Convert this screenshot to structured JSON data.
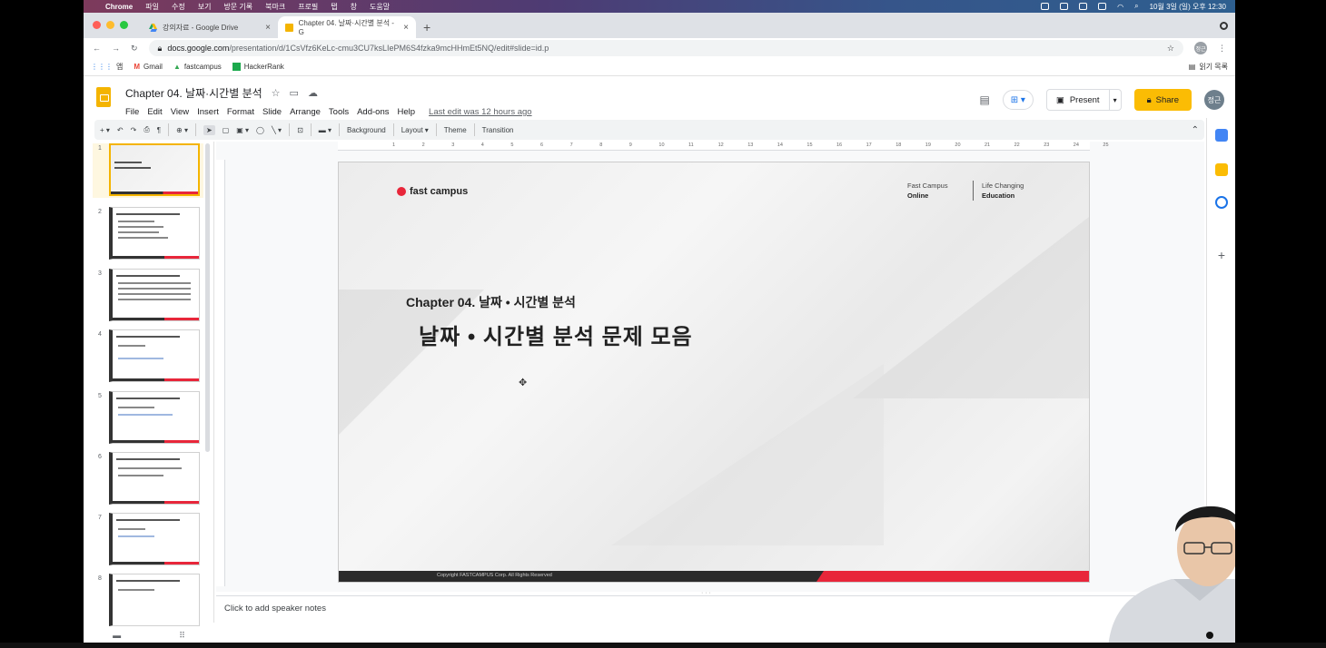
{
  "macbar": {
    "app": "Chrome",
    "menus": [
      "파일",
      "수정",
      "보기",
      "방문 기록",
      "북마크",
      "프로필",
      "탭",
      "창",
      "도움말"
    ],
    "clock": "10월 3일 (일) 오후 12:30"
  },
  "tabs": [
    {
      "label": "강의자료 - Google Drive",
      "active": false
    },
    {
      "label": "Chapter 04. 날짜·시간별 분석 - G",
      "active": true
    }
  ],
  "address": {
    "host": "docs.google.com",
    "path": "/presentation/d/1CsVfz6KeLc-cmu3CU7ksLIePM6S4fzka9mcHHmEt5NQ/edit#slide=id.p",
    "profile": "정근"
  },
  "bookmarks": {
    "apps": "앱",
    "items": [
      "Gmail",
      "fastcampus",
      "HackerRank"
    ],
    "reading_list": "읽기 목록"
  },
  "doc": {
    "title": "Chapter 04. 날짜·시간별 분석",
    "menus": [
      "File",
      "Edit",
      "View",
      "Insert",
      "Format",
      "Slide",
      "Arrange",
      "Tools",
      "Add-ons",
      "Help"
    ],
    "last_edit": "Last edit was 12 hours ago",
    "present_label": "Present",
    "share_label": "Share",
    "avatar": "정근"
  },
  "toolbar": {
    "background": "Background",
    "layout": "Layout",
    "theme": "Theme",
    "transition": "Transition"
  },
  "ruler_ticks": [
    "1",
    "2",
    "3",
    "4",
    "5",
    "6",
    "7",
    "8",
    "9",
    "10",
    "11",
    "12",
    "13",
    "14",
    "15",
    "16",
    "17",
    "18",
    "19",
    "20",
    "21",
    "22",
    "23",
    "24",
    "25"
  ],
  "slides": [
    {
      "num": "1",
      "selected": true
    },
    {
      "num": "2",
      "selected": false
    },
    {
      "num": "3",
      "selected": false
    },
    {
      "num": "4",
      "selected": false
    },
    {
      "num": "5",
      "selected": false
    },
    {
      "num": "6",
      "selected": false
    },
    {
      "num": "7",
      "selected": false
    },
    {
      "num": "8",
      "selected": false
    }
  ],
  "slide": {
    "brand": "fast campus",
    "tagline_left_1": "Fast Campus",
    "tagline_left_2": "Online",
    "tagline_right_1": "Life Changing",
    "tagline_right_2": "Education",
    "chapter": "Chapter  04. 날짜 • 시간별 분석",
    "title": "날짜 • 시간별 분석 문제 모음",
    "copyright": "Copyright FASTCAMPUS Corp. All Rights Reserved"
  },
  "notes": {
    "placeholder": "Click to add speaker notes"
  },
  "colors": {
    "accent": "#fbbc04",
    "brand_red": "#e8263a",
    "selection": "#f4b400"
  }
}
